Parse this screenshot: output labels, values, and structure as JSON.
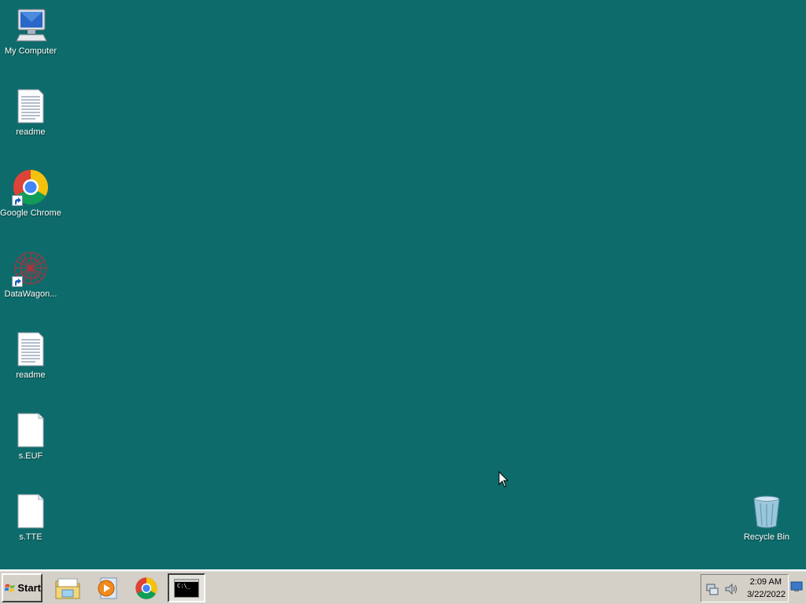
{
  "desktop": {
    "background_color": "#0e6b6b",
    "icons": [
      {
        "label": "My Computer",
        "icon": "computer-icon"
      },
      {
        "label": "readme",
        "icon": "text-document-icon"
      },
      {
        "label": "Google Chrome",
        "icon": "chrome-icon",
        "shortcut": true
      },
      {
        "label": "DataWagon...",
        "icon": "datawagon-icon",
        "shortcut": true
      },
      {
        "label": "readme",
        "icon": "text-document-icon"
      },
      {
        "label": "s.EUF",
        "icon": "blank-file-icon"
      },
      {
        "label": "s.TTE",
        "icon": "blank-file-icon"
      },
      {
        "label": "Recycle Bin",
        "icon": "recycle-bin-icon"
      }
    ]
  },
  "taskbar": {
    "start_label": "Start",
    "quick_launch": [
      {
        "icon": "file-explorer-icon"
      },
      {
        "icon": "media-player-icon"
      },
      {
        "icon": "chrome-icon"
      }
    ],
    "running_tasks": [
      {
        "icon": "command-prompt-icon",
        "icon_text": "C:\\_"
      }
    ],
    "tray": {
      "icons": [
        "network-icon",
        "volume-icon"
      ],
      "time": "2:09 AM",
      "date": "3/22/2022"
    }
  }
}
